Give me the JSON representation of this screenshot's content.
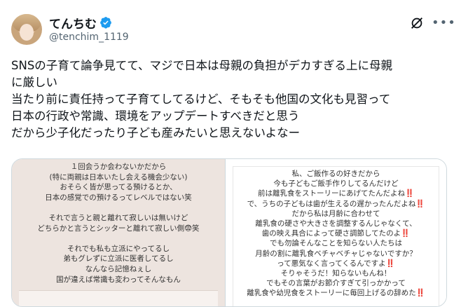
{
  "header": {
    "display_name": "てんちむ",
    "handle": "@tenchim_1119"
  },
  "icons": {
    "verified": "verified-badge-icon",
    "grok": "grok-icon",
    "more": "more-icon"
  },
  "colors": {
    "verified": "#1d9bf0",
    "text": "#0f1419",
    "secondary": "#536471"
  },
  "tweet": {
    "text": "SNSの子育て論争見てて、マジで日本は母親の負担がデカすぎる上に母親\nに厳しい\n当たり前に責任持って子育てしてるけど、そもそも他国の文化も見習って\n日本の行政や常識、環境をアップデートすべきだと思う\nだから少子化だったり子ども産みたいと思えないよなー"
  },
  "media": {
    "left_lines": [
      "１回会うか会わないかだから",
      "(特に両親は日本いたし会える機会少ない)",
      "おそらく皆が思ってる預けるとか、",
      "日本の感覚での預けるってレベルではない笑",
      "",
      "それで言うと親と離れて寂しいは無いけど",
      "どちらかと言うとシッターと離れて寂しい側😨笑",
      "",
      "それでも私も立派にやってるし",
      "弟もグレずに立派に医者してるし",
      "なんなら記憶ねぇし",
      "国が違えば常識も変わってそんなもん"
    ],
    "right_lines": [
      "私、ご飯作るの好きだから",
      "今も子どもご飯手作りしてるんだけど",
      "前は離乳食をストーリーにあげてたんだよね‼️",
      "で、うちの子どもは歯が生えるの遅かったんだよね‼️",
      "だから私は月齢に合わせて",
      "離乳食の硬さや大きさを調整するんじゃなくて、",
      "歯の映え具合によって硬さ調節してたのよ‼️",
      "でも勿論そんなことを知らない人たちは",
      "月齢の割に離乳食ベチャベチャじゃないですか？",
      "って悪気なく言ってくるんですよ‼️",
      "そりゃそうだ！知らないもんね！",
      "でもその言葉がお節介すぎて引っかかって",
      "離乳食や幼児食をストーリーに毎回上げるの辞めた‼️"
    ]
  }
}
